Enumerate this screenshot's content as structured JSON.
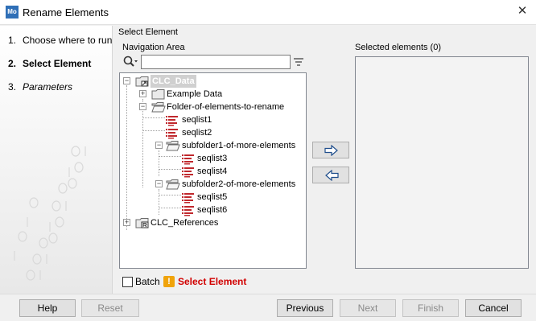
{
  "window": {
    "title": "Rename Elements",
    "app_icon_text": "Mo"
  },
  "steps": [
    {
      "num": "1.",
      "label": "Choose where to run"
    },
    {
      "num": "2.",
      "label": "Select Element"
    },
    {
      "num": "3.",
      "label": "Parameters"
    }
  ],
  "main": {
    "section_title": "Select Element",
    "navigation_label": "Navigation Area",
    "search": {
      "value": "",
      "placeholder": ""
    },
    "selected_label": "Selected elements (0)"
  },
  "tree": {
    "root": "CLC_Data",
    "example_data": "Example Data",
    "folder": "Folder-of-elements-to-rename",
    "seqlist1": "seqlist1",
    "seqlist2": "seqlist2",
    "subfolder1": "subfolder1-of-more-elements",
    "seqlist3": "seqlist3",
    "seqlist4": "seqlist4",
    "subfolder2": "subfolder2-of-more-elements",
    "seqlist5": "seqlist5",
    "seqlist6": "seqlist6",
    "references": "CLC_References"
  },
  "options": {
    "batch_label": "Batch",
    "warning_text": "Select Element",
    "warning_color": "#d10000"
  },
  "footer": {
    "help": "Help",
    "reset": "Reset",
    "previous": "Previous",
    "next": "Next",
    "finish": "Finish",
    "cancel": "Cancel"
  },
  "colors": {
    "seqlist_icon": "#c0282d",
    "folder_icon": "#e8e8e8",
    "accent": "#2f6fb7"
  }
}
